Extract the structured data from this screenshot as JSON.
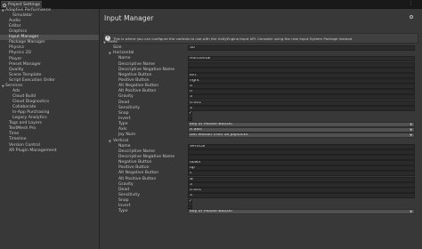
{
  "window": {
    "tab_title": "Project Settings"
  },
  "sidebar": {
    "items": [
      {
        "label": "Adaptive Performance",
        "indent": 0,
        "expanded": true
      },
      {
        "label": "Simulator",
        "indent": 2
      },
      {
        "label": "Audio",
        "indent": 1
      },
      {
        "label": "Editor",
        "indent": 1
      },
      {
        "label": "Graphics",
        "indent": 1
      },
      {
        "label": "Input Manager",
        "indent": 1,
        "selected": true
      },
      {
        "label": "Package Manager",
        "indent": 1
      },
      {
        "label": "Physics",
        "indent": 1
      },
      {
        "label": "Physics 2D",
        "indent": 1
      },
      {
        "label": "Player",
        "indent": 1
      },
      {
        "label": "Preset Manager",
        "indent": 1
      },
      {
        "label": "Quality",
        "indent": 1
      },
      {
        "label": "Scene Template",
        "indent": 1
      },
      {
        "label": "Script Execution Order",
        "indent": 1
      },
      {
        "label": "Services",
        "indent": 0,
        "expanded": true
      },
      {
        "label": "Ads",
        "indent": 2
      },
      {
        "label": "Cloud Build",
        "indent": 2
      },
      {
        "label": "Cloud Diagnostics",
        "indent": 2
      },
      {
        "label": "Collaborate",
        "indent": 2
      },
      {
        "label": "In-App Purchasing",
        "indent": 2
      },
      {
        "label": "Legacy Analytics",
        "indent": 2
      },
      {
        "label": "Tags and Layers",
        "indent": 1
      },
      {
        "label": "TextMesh Pro",
        "indent": 1
      },
      {
        "label": "Time",
        "indent": 1
      },
      {
        "label": "Timeline",
        "indent": 1
      },
      {
        "label": "Version Control",
        "indent": 1
      },
      {
        "label": "XR Plugin Management",
        "indent": 1
      }
    ]
  },
  "main": {
    "title": "Input Manager",
    "info": "This is where you can configure the controls to use with the UnityEngine.Input API. Consider using the new Input System Package instead.",
    "rows": [
      {
        "label": "Axes",
        "level": 0,
        "foldout": true
      },
      {
        "label": "Size",
        "level": 1,
        "value": "30"
      },
      {
        "label": "Horizontal",
        "level": 1,
        "foldout": true
      },
      {
        "label": "Name",
        "level": 2,
        "value": "Horizontal"
      },
      {
        "label": "Descriptive Name",
        "level": 2,
        "value": ""
      },
      {
        "label": "Descriptive Negative Name",
        "level": 2,
        "value": ""
      },
      {
        "label": "Negative Button",
        "level": 2,
        "value": "left"
      },
      {
        "label": "Positive Button",
        "level": 2,
        "value": "right"
      },
      {
        "label": "Alt Negative Button",
        "level": 2,
        "value": "a"
      },
      {
        "label": "Alt Positive Button",
        "level": 2,
        "value": "d"
      },
      {
        "label": "Gravity",
        "level": 2,
        "value": "3"
      },
      {
        "label": "Dead",
        "level": 2,
        "value": "0.001"
      },
      {
        "label": "Sensitivity",
        "level": 2,
        "value": "3"
      },
      {
        "label": "Snap",
        "level": 2,
        "check": true
      },
      {
        "label": "Invert",
        "level": 2,
        "check": false
      },
      {
        "label": "Type",
        "level": 2,
        "value": "Key or Mouse Button",
        "dropdown": true
      },
      {
        "label": "Axis",
        "level": 2,
        "value": "X axis",
        "dropdown": true
      },
      {
        "label": "Joy Num",
        "level": 2,
        "value": "Get Motion from all Joysticks",
        "dropdown": true
      },
      {
        "label": "Vertical",
        "level": 1,
        "foldout": true
      },
      {
        "label": "Name",
        "level": 2,
        "value": "Vertical"
      },
      {
        "label": "Descriptive Name",
        "level": 2,
        "value": ""
      },
      {
        "label": "Descriptive Negative Name",
        "level": 2,
        "value": ""
      },
      {
        "label": "Negative Button",
        "level": 2,
        "value": "down"
      },
      {
        "label": "Positive Button",
        "level": 2,
        "value": "up"
      },
      {
        "label": "Alt Negative Button",
        "level": 2,
        "value": "s"
      },
      {
        "label": "Alt Positive Button",
        "level": 2,
        "value": "w"
      },
      {
        "label": "Gravity",
        "level": 2,
        "value": "3"
      },
      {
        "label": "Dead",
        "level": 2,
        "value": "0.001"
      },
      {
        "label": "Sensitivity",
        "level": 2,
        "value": "3"
      },
      {
        "label": "Snap",
        "level": 2,
        "check": true
      },
      {
        "label": "Invert",
        "level": 2,
        "check": false
      },
      {
        "label": "Type",
        "level": 2,
        "value": "Key or Mouse Button",
        "dropdown": true
      }
    ]
  },
  "icons": {
    "tab": "gear-icon",
    "info": "info-icon",
    "settings": "gear-icon"
  },
  "colors": {
    "background": "#383838",
    "selection": "#4d4d4d",
    "field": "#2a2a2a"
  }
}
